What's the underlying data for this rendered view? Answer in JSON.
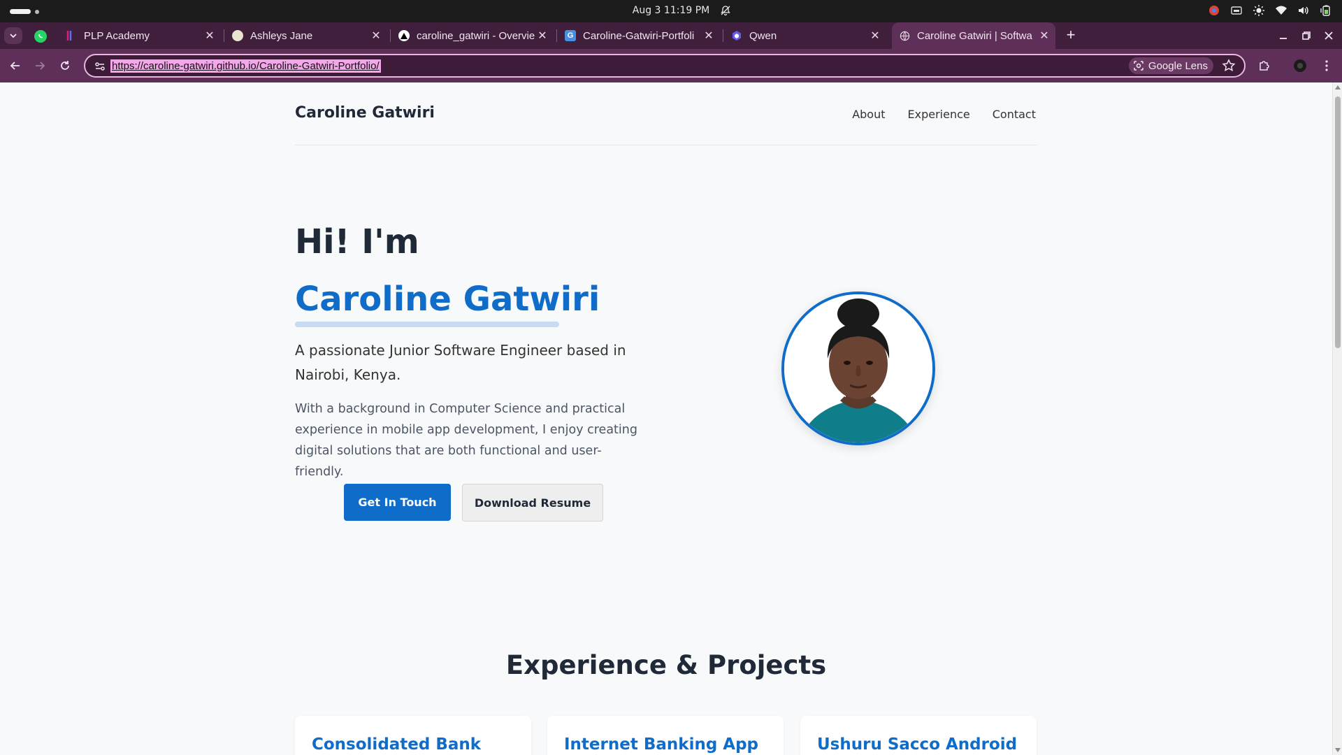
{
  "os": {
    "clock": "Aug 3  11:19 PM"
  },
  "tabs": [
    {
      "title": "PLP Academy",
      "icon": "plp-favicon"
    },
    {
      "title": "Ashleys Jane",
      "icon": "globe-favicon"
    },
    {
      "title": "caroline_gatwiri - Overvie",
      "icon": "vercel-favicon"
    },
    {
      "title": "Caroline-Gatwiri-Portfoli",
      "icon": "github-pages-favicon"
    },
    {
      "title": "Qwen",
      "icon": "qwen-favicon"
    },
    {
      "title": "Caroline Gatwiri | Softwa",
      "icon": "globe-favicon",
      "active": true
    }
  ],
  "toolbar": {
    "url": "https://caroline-gatwiri.github.io/Caroline-Gatwiri-Portfolio/",
    "lens_label": "Google Lens"
  },
  "site": {
    "brand": "Caroline Gatwiri",
    "nav": [
      "About",
      "Experience",
      "Contact"
    ],
    "hero": {
      "greeting": "Hi! I'm",
      "name": "Caroline Gatwiri",
      "tagline": "A passionate Junior Software Engineer based in Nairobi, Kenya.",
      "description": "With a background in Computer Science and practical experience in mobile app development, I enjoy creating digital solutions that are both functional and user-friendly.",
      "primary_button": "Get In Touch",
      "secondary_button": "Download Resume"
    },
    "section_title": "Experience & Projects",
    "projects": [
      "Consolidated Bank",
      "Internet Banking App",
      "Ushuru Sacco Android"
    ]
  },
  "colors": {
    "accent": "#0f6cc9",
    "tab_strip": "#3f1f3b",
    "toolbar": "#5e2f58"
  }
}
